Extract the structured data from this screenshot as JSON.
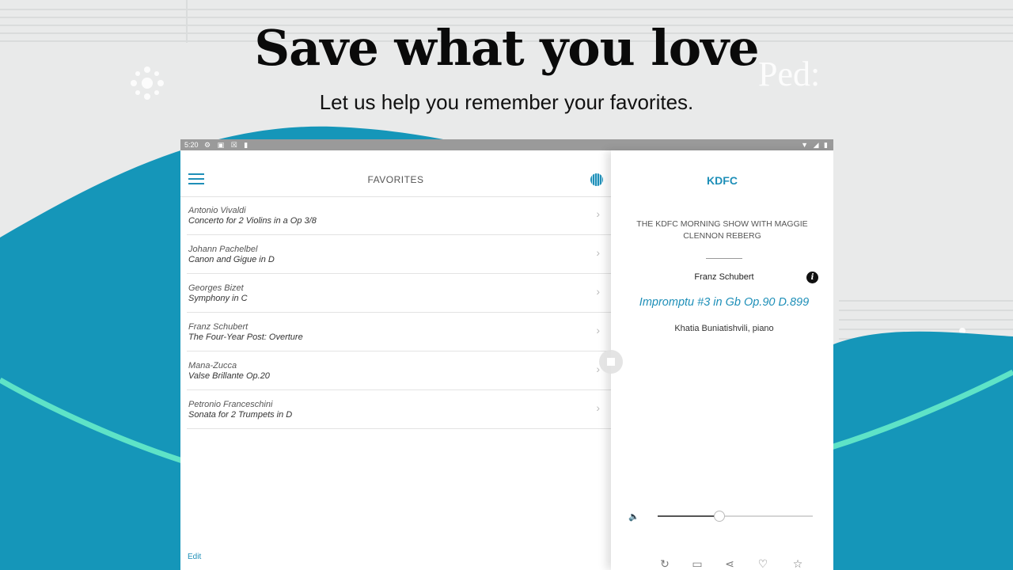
{
  "promo": {
    "headline": "Save what you love",
    "subline": "Let us help you remember your favorites."
  },
  "background": {
    "music_text": "Ped:",
    "wave_color": "#1596b9",
    "stripe_color": "#5ee3c7"
  },
  "statusbar": {
    "time": "5:20",
    "icons": [
      "settings-icon",
      "sim-icon",
      "x-icon",
      "sd-card-icon"
    ],
    "right_icons": [
      "wifi-icon",
      "signal-icon",
      "battery-icon"
    ]
  },
  "left_pane": {
    "title": "FAVORITES",
    "edit_label": "Edit",
    "favorites": [
      {
        "composer": "Antonio Vivaldi",
        "work": "Concerto for 2 Violins in a Op 3/8"
      },
      {
        "composer": "Johann Pachelbel",
        "work": "Canon and Gigue in D"
      },
      {
        "composer": "Georges Bizet",
        "work": "Symphony in C"
      },
      {
        "composer": "Franz Schubert",
        "work": "The Four-Year Post: Overture"
      },
      {
        "composer": "Mana-Zucca",
        "work": "Valse Brillante Op.20"
      },
      {
        "composer": "Petronio Franceschini",
        "work": "Sonata for 2 Trumpets in D"
      }
    ]
  },
  "now_playing": {
    "station": "KDFC",
    "show": "THE KDFC MORNING SHOW WITH MAGGIE CLENNON REBERG",
    "composer": "Franz Schubert",
    "work": "Impromptu #3 in Gb Op.90 D.899",
    "performer": "Khatia Buniatishvili, piano",
    "volume": 0.4,
    "info_glyph": "i",
    "controls": [
      "replay-icon",
      "cast-icon",
      "share-icon",
      "heart-icon",
      "star-icon"
    ]
  },
  "colors": {
    "accent": "#1e8fb8",
    "status_bar": "#9a9a9a"
  }
}
